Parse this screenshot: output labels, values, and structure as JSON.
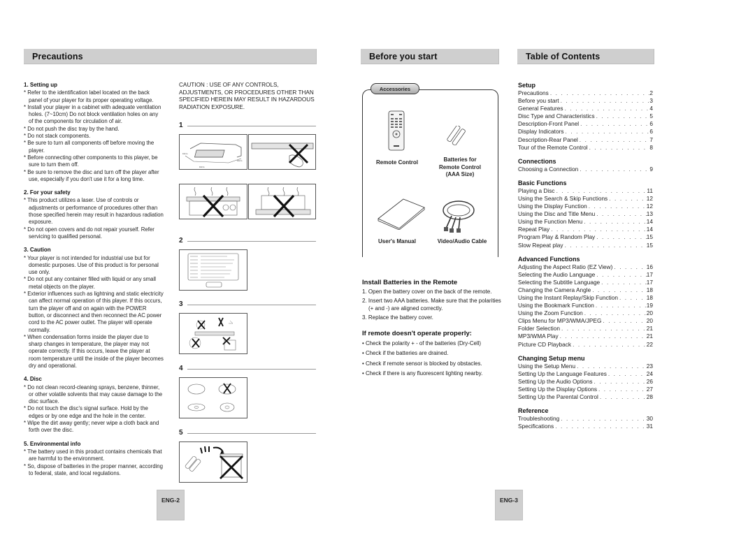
{
  "precautions": {
    "header": "Precautions",
    "sections": [
      {
        "title": "1. Setting up",
        "items": [
          "Refer to the identification label located on the back panel of your player for its proper operating voltage.",
          "Install your player in a cabinet with adequate ventilation holes. (7~10cm) Do not block ventilation holes on any of the components for circulation of air.",
          "Do not push the disc tray by the hand.",
          "Do not stack components.",
          "Be sure to turn all components off before moving the player.",
          "Before connecting other components to this player, be sure to turn them off.",
          "Be sure to remove the disc and turn off the player after use, especially if you don't use it for a long time."
        ]
      },
      {
        "title": "2. For your safety",
        "items": [
          "This product utilizes a laser. Use of controls or adjustments or performance of procedures other than those specified herein may result in hazardous radiation exposure.",
          "Do not open covers and do not repair yourself. Refer servicing to qualified personal."
        ]
      },
      {
        "title": "3. Caution",
        "items": [
          "Your player is not intended for industrial use but for domestic purposes. Use of this product is for personal use only.",
          "Do not put any container filled with liquid or any small metal objects on the player.",
          "Exterior influences such as lightning and static electricity can affect normal operation of this player. If this occurs, turn the player off and on again with the POWER button, or disconnect and then reconnect the AC power cord to the AC power outlet. The player will operate normally.",
          "When condensation forms inside the player due to sharp changes in temperature, the player may not operate correctly. If this occurs, leave the player at room temperature until the inside of the player becomes dry and operational."
        ]
      },
      {
        "title": "4. Disc",
        "items": [
          "Do not clean record-cleaning sprays, benzene, thinner, or other volatile solvents that may cause damage to the disc surface.",
          "Do not touch the disc's signal surface. Hold by the edges or by one edge and the hole in the center.",
          "Wipe the dirt away gently; never wipe a cloth back and forth over the disc."
        ]
      },
      {
        "title": "5. Environmental info",
        "items": [
          "The battery used in this product contains chemicals that are harmful to the environment.",
          "So, dispose of batteries in the proper manner, according to federal, state, and local regulations."
        ]
      }
    ],
    "caution_text": "CAUTION : USE OF ANY CONTROLS, ADJUSTMENTS, OR PROCEDURES OTHER THAN SPECIFIED HEREIN MAY RESULT IN HAZARDOUS RADIATION EXPOSURE.",
    "steps": [
      "1",
      "2",
      "3",
      "4",
      "5"
    ],
    "bullet_char": "*",
    "page_label": "ENG-2"
  },
  "before_start": {
    "header": "Before you start",
    "accessories_label": "Accessories",
    "accessories": [
      {
        "name": "Remote Control"
      },
      {
        "name": "Batteries for Remote Control (AAA Size)",
        "lines": [
          "Batteries for",
          "Remote Control",
          "(AAA Size)"
        ]
      },
      {
        "name": "User's Manual"
      },
      {
        "name": "Video/Audio Cable"
      }
    ],
    "install_title": "Install Batteries in the Remote",
    "install_steps": [
      "1. Open the battery cover on the back of the remote.",
      "2. Insert two AAA batteries. Make sure that the polarities (+ and -) are aligned correctly.",
      "3. Replace the battery cover."
    ],
    "remote_title": "If remote doesn't operate properly:",
    "remote_checks": [
      "• Check the polarity + - of the batteries (Dry-Cell)",
      "• Check if the batteries are drained.",
      "• Check if remote sensor is blocked by obstacles.",
      "• Check if there is any fluorescent lighting nearby."
    ],
    "page_label": "ENG-3"
  },
  "toc": {
    "header": "Table of Contents",
    "groups": [
      {
        "title": "Setup",
        "entries": [
          {
            "label": "Precautions",
            "page": "2"
          },
          {
            "label": "Before you start",
            "page": "3"
          },
          {
            "label": "General Features",
            "page": "4"
          },
          {
            "label": "Disc Type and Characteristics",
            "page": "5"
          },
          {
            "label": "Description-Front Panel",
            "page": "6"
          },
          {
            "label": "Display Indicators",
            "page": "6"
          },
          {
            "label": "Description-Rear Panel",
            "page": "7"
          },
          {
            "label": "Tour of the Remote Control",
            "page": "8"
          }
        ]
      },
      {
        "title": "Connections",
        "entries": [
          {
            "label": "Choosing a Connection",
            "page": "9"
          }
        ]
      },
      {
        "title": "Basic Functions",
        "entries": [
          {
            "label": "Playing a Disc",
            "page": "11"
          },
          {
            "label": "Using the Search & Skip Functions",
            "page": "12"
          },
          {
            "label": "Using the Display Function",
            "page": "12"
          },
          {
            "label": "Using the Disc and Title Menu",
            "page": "13"
          },
          {
            "label": "Using the Function Menu",
            "page": "14"
          },
          {
            "label": "Repeat Play",
            "page": "14"
          },
          {
            "label": "Program Play & Random Play",
            "page": "15"
          },
          {
            "label": "Slow Repeat play",
            "page": "15"
          }
        ]
      },
      {
        "title": "Advanced Functions",
        "entries": [
          {
            "label": "Adjusting the Aspect Ratio (EZ View)",
            "page": "16"
          },
          {
            "label": "Selecting the Audio Language",
            "page": "17"
          },
          {
            "label": "Selecting the Subtitle Language",
            "page": "17"
          },
          {
            "label": "Changing the Camera Angle",
            "page": "18"
          },
          {
            "label": "Using the Instant Replay/Skip Function",
            "page": "18"
          },
          {
            "label": "Using the Bookmark Function",
            "page": "19"
          },
          {
            "label": "Using the Zoom Function",
            "page": "20"
          },
          {
            "label": "Clips Menu for MP3/WMA/JPEG",
            "page": "20"
          },
          {
            "label": "Folder Selection",
            "page": "21"
          },
          {
            "label": "MP3/WMA Play",
            "page": "21"
          },
          {
            "label": "Picture CD Playback",
            "page": "22"
          }
        ]
      },
      {
        "title": "Changing Setup menu",
        "entries": [
          {
            "label": "Using the Setup Menu",
            "page": "23"
          },
          {
            "label": "Setting Up the Language Features",
            "page": "24"
          },
          {
            "label": "Setting Up the Audio Options",
            "page": "26"
          },
          {
            "label": "Setting Up the Display Options",
            "page": "27"
          },
          {
            "label": "Setting Up the Parental Control",
            "page": "28"
          }
        ]
      },
      {
        "title": "Reference",
        "entries": [
          {
            "label": "Troubleshooting",
            "page": "30"
          },
          {
            "label": "Specifications",
            "page": "31"
          }
        ]
      }
    ]
  },
  "colors": {
    "header_bg": "#cfcfcf",
    "page_tab_bg": "#cfcfcf",
    "text": "#1a1a1a"
  }
}
